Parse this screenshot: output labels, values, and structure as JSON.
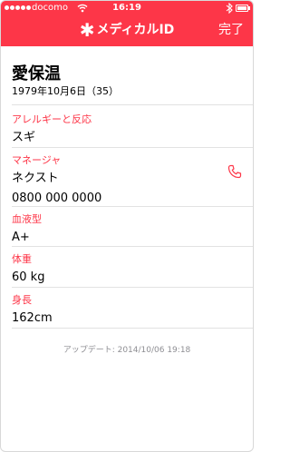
{
  "status_bar": {
    "carrier": "docomo",
    "time": "16:19",
    "signal_icon": "signal-dots-icon",
    "wifi_icon": "wifi-icon",
    "bluetooth_icon": "bluetooth-icon",
    "battery_icon": "battery-icon"
  },
  "nav": {
    "title": "メディカルID",
    "title_icon": "medical-asterisk-icon",
    "done_label": "完了",
    "bar_color": "#fd3648"
  },
  "profile": {
    "name": "愛保温",
    "birth": "1979年10月6日（35）"
  },
  "sections": {
    "allergies": {
      "label": "アレルギーと反応",
      "value": "スギ"
    },
    "manager": {
      "label": "マネージャ",
      "name": "ネクスト",
      "phone": "0800 000 0000",
      "icon": "phone-icon"
    },
    "blood_type": {
      "label": "血液型",
      "value": "A+"
    },
    "weight": {
      "label": "体重",
      "value": "60 kg"
    },
    "height": {
      "label": "身長",
      "value": "162cm"
    }
  },
  "footer": {
    "updated": "アップデート: 2014/10/06 19:18"
  },
  "colors": {
    "accent": "#fd3648",
    "divider": "#e2e2e2",
    "muted_text": "#8e8e93"
  }
}
